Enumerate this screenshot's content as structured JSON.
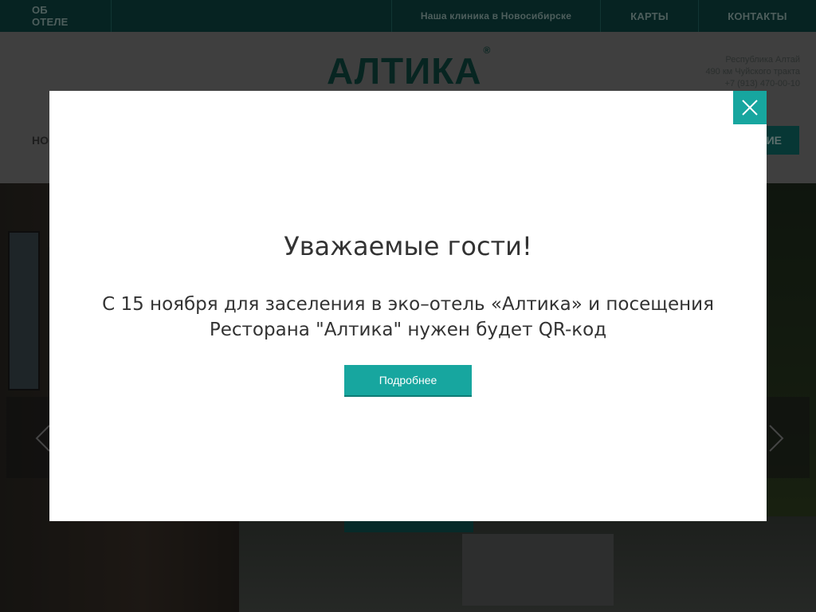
{
  "topbar": {
    "about": "ОБ ОТЕЛЕ",
    "clinic": "Наша клиника в Новосибирске",
    "maps": "КАРТЫ",
    "contacts": "КОНТАКТЫ"
  },
  "header": {
    "logo_text": "АЛТИКА",
    "logo_mark": "®",
    "address_lines": [
      "Республика Алтай",
      "490 км Чуйского тракта",
      "+7 (913) 470-00-10"
    ],
    "nav_left_partial": "НО",
    "nav_button_partial": "ИЕ"
  },
  "modal": {
    "title": "Уважаемые гости!",
    "text": "С 15 ноября для заселения в эко–отель «Алтика» и посещения Ресторана \"Алтика\" нужен будет QR-код",
    "button_label": "Подробнее",
    "close_icon": "close-icon"
  },
  "colors": {
    "topbar_bg": "#0d4644",
    "accent": "#17a69f",
    "logo": "#0f4a42"
  }
}
